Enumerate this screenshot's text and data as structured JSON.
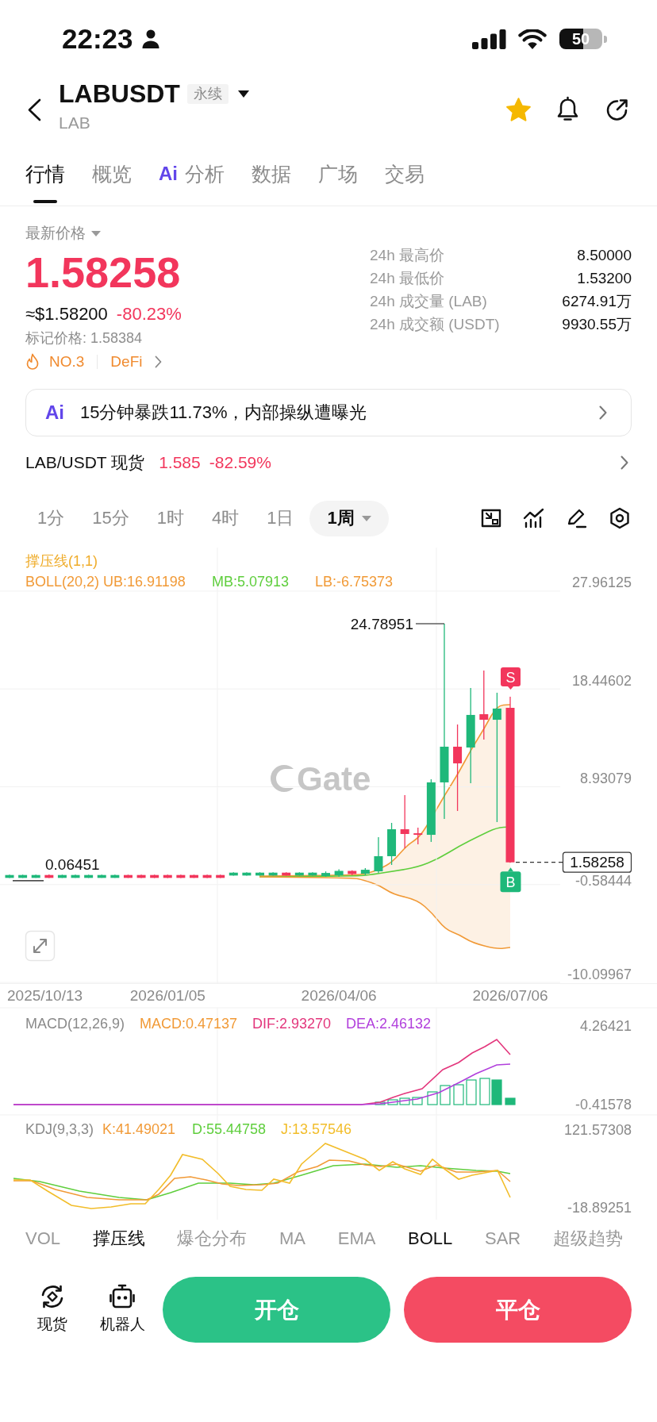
{
  "status_bar": {
    "time": "22:23",
    "battery": "50"
  },
  "header": {
    "symbol": "LABUSDT",
    "contract_tag": "永续",
    "base_asset": "LAB",
    "favorite": true
  },
  "tabs": [
    {
      "label": "行情",
      "selected": true
    },
    {
      "label": "概览",
      "selected": false
    },
    {
      "label": "分析",
      "prefix": "Ai",
      "selected": false
    },
    {
      "label": "数据",
      "selected": false
    },
    {
      "label": "广场",
      "selected": false
    },
    {
      "label": "交易",
      "selected": false
    }
  ],
  "price": {
    "label": "最新价格",
    "last": "1.58258",
    "usd": "≈$1.58200",
    "change": "-80.23%",
    "mark": "标记价格: 1.58384",
    "rank": "NO.3",
    "sector": "DeFi"
  },
  "stats": [
    {
      "label": "24h 最高价",
      "value": "8.50000"
    },
    {
      "label": "24h 最低价",
      "value": "1.53200"
    },
    {
      "label": "24h 成交量 (LAB)",
      "value": "6274.91万"
    },
    {
      "label": "24h 成交额 (USDT)",
      "value": "9930.55万"
    }
  ],
  "ai_news": {
    "logo": "Ai",
    "headline": "15分钟暴跌11.73%，内部操纵遭曝光"
  },
  "spot": {
    "pair": "LAB/USDT 现货",
    "price": "1.585",
    "change": "-82.59%"
  },
  "timeframes": [
    {
      "label": "1分",
      "selected": false,
      "dropdown": false
    },
    {
      "label": "15分",
      "selected": false,
      "dropdown": false
    },
    {
      "label": "1时",
      "selected": false,
      "dropdown": false
    },
    {
      "label": "4时",
      "selected": false,
      "dropdown": false
    },
    {
      "label": "1日",
      "selected": false,
      "dropdown": false
    },
    {
      "label": "1周",
      "selected": true,
      "dropdown": true
    }
  ],
  "chart": {
    "overlay": "撑压线(1,1)",
    "legend": [
      {
        "text": "BOLL(20,2) UB:16.91198",
        "color": "#f19a37"
      },
      {
        "text": "MB:5.07913",
        "color": "#5fce3d"
      },
      {
        "text": "LB:-6.75373",
        "color": "#f19a37"
      }
    ],
    "high": "24.78951",
    "low": "0.06451",
    "last_price": "1.58258",
    "sell_marker": "S",
    "buy_marker": "B",
    "watermark": "Gate",
    "start_date": "2025/10/13",
    "chart_data": {
      "type": "candlestick",
      "grid": true,
      "categories": [
        null,
        null,
        null,
        null,
        null,
        null,
        null,
        null,
        null,
        null,
        null,
        null,
        "2026/01/05",
        null,
        null,
        null,
        null,
        null,
        null,
        null,
        null,
        null,
        null,
        null,
        null,
        "2026/04/06",
        null,
        null,
        null,
        null,
        null,
        null,
        null,
        null,
        null,
        null,
        null,
        null,
        "2026/07/06"
      ],
      "ohlc": [
        [
          0.07,
          0.38,
          0.06451,
          0.35
        ],
        [
          0.07,
          0.38,
          0.066,
          0.35
        ],
        [
          0.07,
          0.38,
          0.066,
          0.35
        ],
        [
          0.35,
          0.4,
          0.065,
          0.07
        ],
        [
          0.07,
          0.38,
          0.066,
          0.35
        ],
        [
          0.07,
          0.38,
          0.066,
          0.35
        ],
        [
          0.07,
          0.38,
          0.066,
          0.35
        ],
        [
          0.07,
          0.38,
          0.066,
          0.35
        ],
        [
          0.07,
          0.38,
          0.066,
          0.35
        ],
        [
          0.35,
          0.38,
          0.065,
          0.07
        ],
        [
          0.35,
          0.38,
          0.065,
          0.07
        ],
        [
          0.35,
          0.38,
          0.065,
          0.07
        ],
        [
          0.35,
          0.38,
          0.065,
          0.07
        ],
        [
          0.35,
          0.38,
          0.065,
          0.07
        ],
        [
          0.35,
          0.38,
          0.065,
          0.07
        ],
        [
          0.35,
          0.38,
          0.065,
          0.07
        ],
        [
          0.35,
          0.38,
          0.065,
          0.07
        ],
        [
          0.3,
          0.62,
          0.28,
          0.58
        ],
        [
          0.3,
          0.62,
          0.28,
          0.58
        ],
        [
          0.3,
          0.62,
          0.28,
          0.58
        ],
        [
          0.3,
          0.62,
          0.28,
          0.58
        ],
        [
          0.58,
          0.62,
          0.28,
          0.3
        ],
        [
          0.3,
          0.62,
          0.28,
          0.58
        ],
        [
          0.3,
          0.62,
          0.28,
          0.58
        ],
        [
          0.25,
          0.7,
          0.17,
          0.55
        ],
        [
          0.32,
          0.9,
          0.17,
          0.75
        ],
        [
          0.75,
          0.8,
          0.32,
          0.45
        ],
        [
          0.48,
          1.02,
          0.32,
          0.86
        ],
        [
          0.71,
          4.03,
          0.55,
          2.18
        ],
        [
          2.18,
          5.42,
          1.33,
          4.8
        ],
        [
          4.8,
          8.12,
          2.95,
          4.34
        ],
        [
          4.41,
          4.96,
          3.33,
          4.26
        ],
        [
          4.26,
          9.66,
          3.57,
          9.36
        ],
        [
          9.36,
          24.78951,
          5.8,
          12.83
        ],
        [
          12.83,
          14.99,
          6.58,
          11.21
        ],
        [
          12.75,
          18.54,
          9.28,
          15.92
        ],
        [
          15.99,
          20.24,
          13.52,
          15.45
        ],
        [
          15.45,
          18.08,
          5.5,
          16.54
        ],
        [
          16.61,
          17.69,
          1.532,
          1.58258
        ]
      ],
      "ylim": [
        -10.17,
        32.2
      ],
      "yticks": [
        27.96125,
        18.44602,
        8.93079,
        -0.58444,
        -10.09967
      ]
    }
  },
  "macd": {
    "title": "MACD(12,26,9)",
    "legend": [
      {
        "text": "MACD:0.47137",
        "color": "#f19a37"
      },
      {
        "text": "DIF:2.93270",
        "color": "#e3367c"
      },
      {
        "text": "DEA:2.46132",
        "color": "#b13fdc"
      }
    ],
    "y_labels": [
      "4.26421",
      "-0.41578"
    ]
  },
  "kdj": {
    "title": "KDJ(9,3,3)",
    "legend": [
      {
        "text": "K:41.49021",
        "color": "#f19a37"
      },
      {
        "text": "D:55.44758",
        "color": "#5fce3d"
      },
      {
        "text": "J:13.57546",
        "color": "#f2bd2a"
      }
    ],
    "y_labels": [
      "121.57308",
      "-18.89251"
    ]
  },
  "indicators": [
    {
      "label": "VOL",
      "selected": false
    },
    {
      "label": "撑压线",
      "selected": true
    },
    {
      "label": "爆仓分布",
      "selected": false
    },
    {
      "label": "MA",
      "selected": false
    },
    {
      "label": "EMA",
      "selected": false
    },
    {
      "label": "BOLL",
      "selected": true
    },
    {
      "label": "SAR",
      "selected": false
    },
    {
      "label": "超级趋势",
      "selected": false
    }
  ],
  "bottom_bar": {
    "shortcuts": [
      {
        "label": "现货",
        "kind": "spot"
      },
      {
        "label": "机器人",
        "kind": "robot"
      }
    ],
    "open_button": "开仓",
    "close_button": "平仓"
  }
}
